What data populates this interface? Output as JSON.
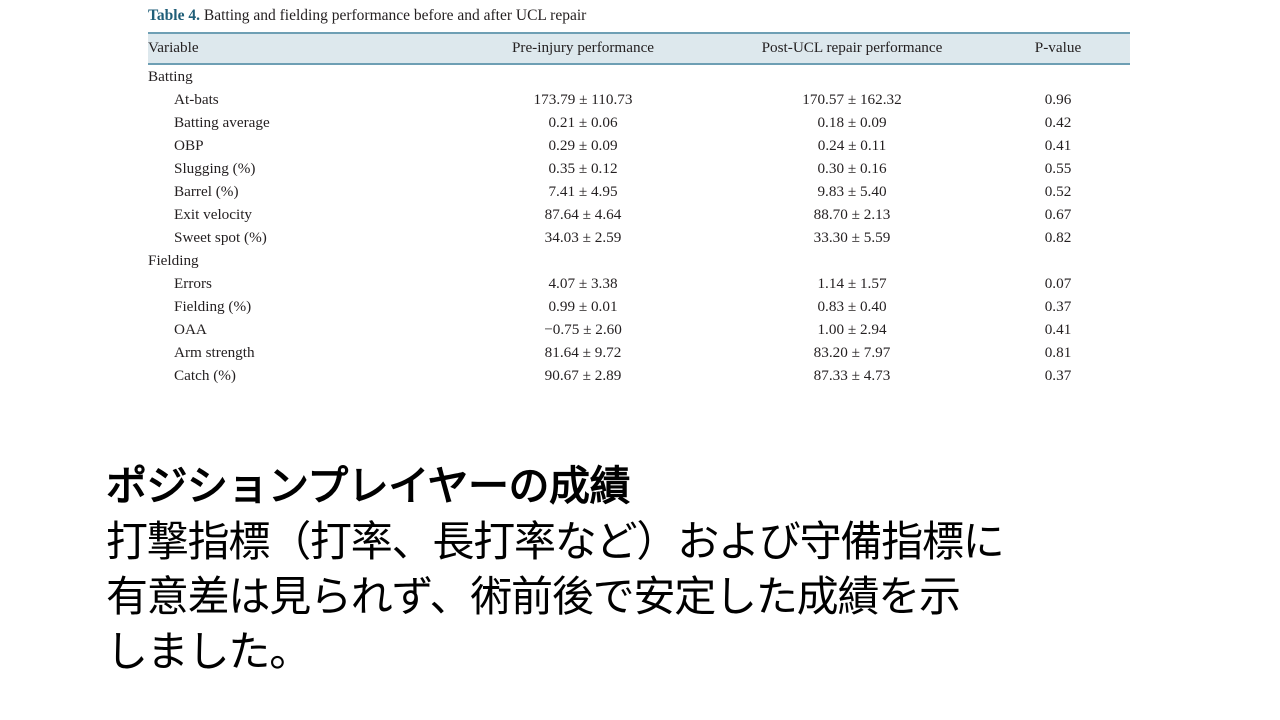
{
  "table": {
    "caption_label": "Table 4.",
    "caption_text": " Batting and fielding performance before and after UCL repair",
    "header_bg": "#dde8ed",
    "header_rule": "#6e9fb4",
    "label_color": "#1f5e78",
    "columns": [
      {
        "key": "variable",
        "label": "Variable"
      },
      {
        "key": "pre",
        "label": "Pre-injury performance"
      },
      {
        "key": "post",
        "label": "Post-UCL repair performance"
      },
      {
        "key": "pvalue",
        "label": "P-value"
      }
    ],
    "rows": [
      {
        "variable": "Batting",
        "indent": false,
        "pre": "",
        "post": "",
        "pvalue": ""
      },
      {
        "variable": "At-bats",
        "indent": true,
        "pre": "173.79 ± 110.73",
        "post": "170.57 ± 162.32",
        "pvalue": "0.96"
      },
      {
        "variable": "Batting average",
        "indent": true,
        "pre": "0.21 ± 0.06",
        "post": "0.18 ± 0.09",
        "pvalue": "0.42"
      },
      {
        "variable": "OBP",
        "indent": true,
        "pre": "0.29 ± 0.09",
        "post": "0.24 ± 0.11",
        "pvalue": "0.41"
      },
      {
        "variable": "Slugging (%)",
        "indent": true,
        "pre": "0.35 ± 0.12",
        "post": "0.30 ± 0.16",
        "pvalue": "0.55"
      },
      {
        "variable": "Barrel (%)",
        "indent": true,
        "pre": "7.41 ± 4.95",
        "post": "9.83 ± 5.40",
        "pvalue": "0.52"
      },
      {
        "variable": "Exit velocity",
        "indent": true,
        "pre": "87.64 ± 4.64",
        "post": "88.70 ± 2.13",
        "pvalue": "0.67"
      },
      {
        "variable": "Sweet spot (%)",
        "indent": true,
        "pre": "34.03 ± 2.59",
        "post": "33.30 ± 5.59",
        "pvalue": "0.82"
      },
      {
        "variable": "Fielding",
        "indent": false,
        "pre": "",
        "post": "",
        "pvalue": ""
      },
      {
        "variable": "Errors",
        "indent": true,
        "pre": "4.07 ± 3.38",
        "post": "1.14 ± 1.57",
        "pvalue": "0.07"
      },
      {
        "variable": "Fielding (%)",
        "indent": true,
        "pre": "0.99 ± 0.01",
        "post": "0.83 ± 0.40",
        "pvalue": "0.37"
      },
      {
        "variable": "OAA",
        "indent": true,
        "pre": "−0.75 ± 2.60",
        "post": "1.00 ± 2.94",
        "pvalue": "0.41"
      },
      {
        "variable": "Arm strength",
        "indent": true,
        "pre": "81.64 ± 9.72",
        "post": "83.20 ± 7.97",
        "pvalue": "0.81"
      },
      {
        "variable": "Catch (%)",
        "indent": true,
        "pre": "90.67 ± 2.89",
        "post": "87.33 ± 4.73",
        "pvalue": "0.37"
      }
    ]
  },
  "commentary": {
    "heading": "ポジションプレイヤーの成績",
    "lines": [
      "打撃指標（打率、長打率など）および守備指標に",
      "有意差は見られず、術前後で安定した成績を示",
      "しました。"
    ]
  }
}
